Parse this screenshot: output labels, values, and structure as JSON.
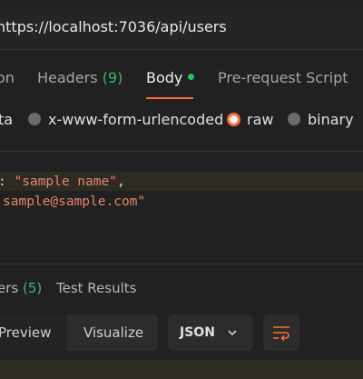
{
  "request": {
    "url": "https://localhost:7036/api/users"
  },
  "request_tabs": {
    "params_partial": "on",
    "headers_label": "Headers",
    "headers_count": "(9)",
    "body_label": "Body",
    "prerequest_label": "Pre-request Script"
  },
  "body_modes": {
    "formdata_partial": "ta",
    "urlencoded": "x-www-form-urlencoded",
    "raw": "raw",
    "binary": "binary",
    "selected": "raw"
  },
  "editor": {
    "line1_punct": ": ",
    "line1_value": "\"sample name\"",
    "line1_comma": ",",
    "line2_value": "sample@sample.com\""
  },
  "response_tabs": {
    "headers_partial": "ers",
    "headers_count": "(5)",
    "test_results": "Test Results"
  },
  "response_view": {
    "preview": "Preview",
    "visualize": "Visualize",
    "format": "JSON"
  },
  "colors": {
    "accent": "#ff6c37",
    "count_green": "#3fb86b",
    "string": "#e8856a"
  }
}
